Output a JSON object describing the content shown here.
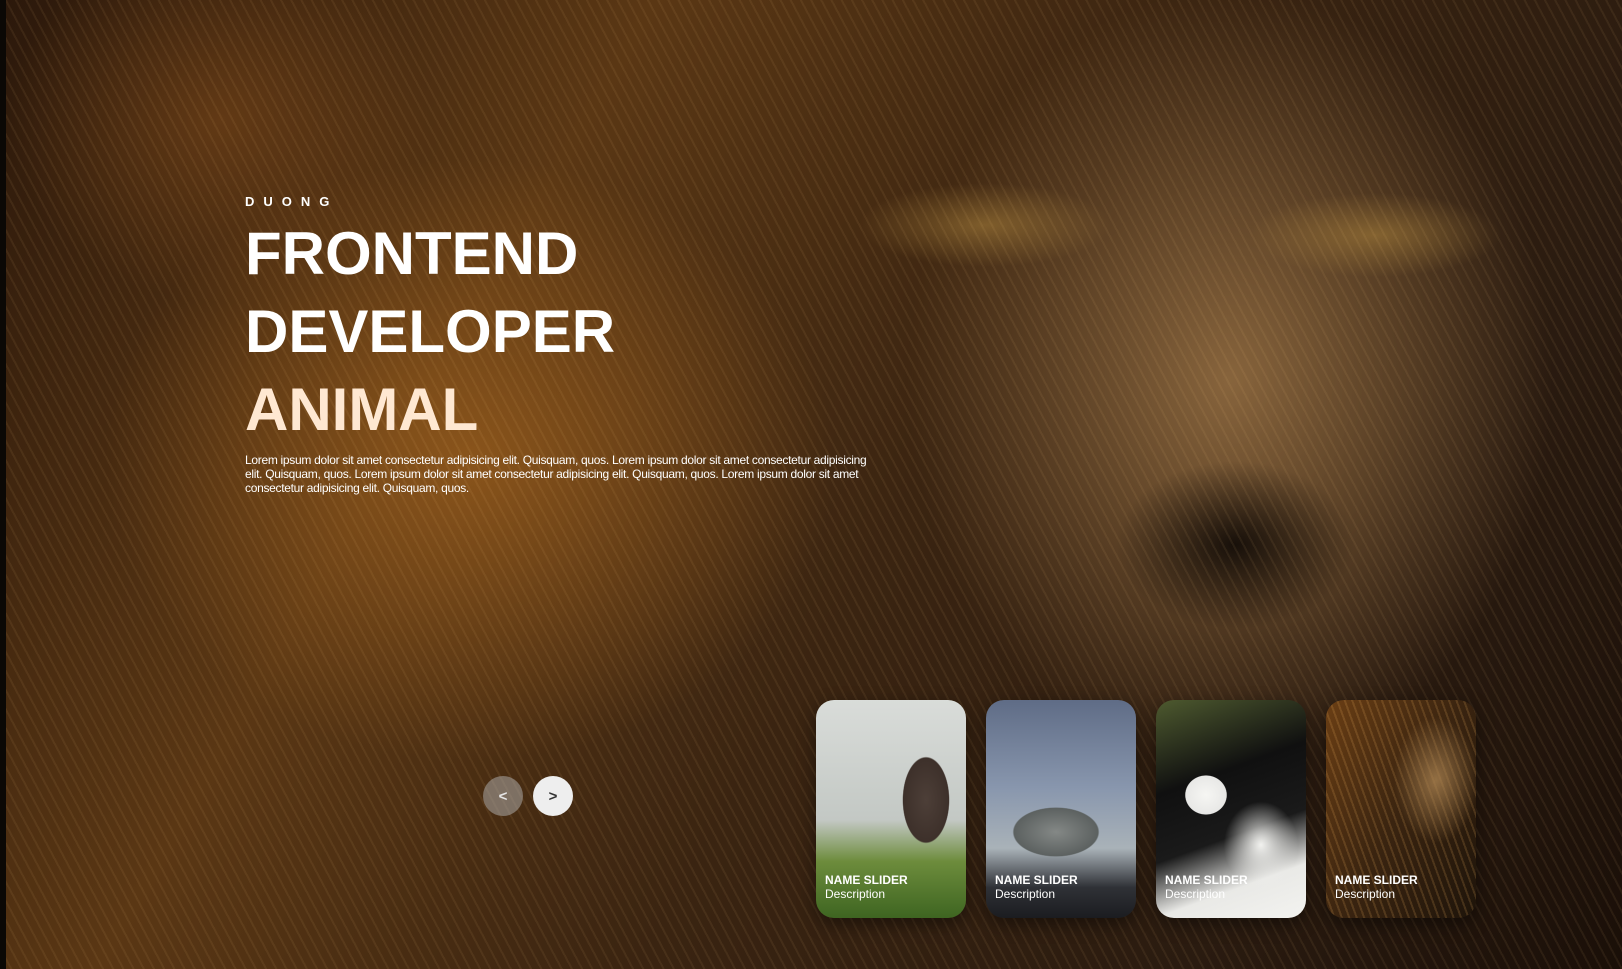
{
  "hero": {
    "eyebrow": "DUONG",
    "title_line1": "FRONTEND",
    "title_line2": "DEVELOPER",
    "title_line3": "ANIMAL",
    "description": "Lorem ipsum dolor sit amet consectetur adipisicing elit. Quisquam, quos. Lorem ipsum dolor sit amet consectetur adipisicing elit. Quisquam, quos. Lorem ipsum dolor sit amet consectetur adipisicing elit. Quisquam, quos. Lorem ipsum dolor sit amet consectetur adipisicing elit. Quisquam, quos."
  },
  "controls": {
    "prev_label": "<",
    "next_label": ">"
  },
  "cards": [
    {
      "title": "NAME SLIDER",
      "description": "Description",
      "animal": "hippo"
    },
    {
      "title": "NAME SLIDER",
      "description": "Description",
      "animal": "dinosaur"
    },
    {
      "title": "NAME SLIDER",
      "description": "Description",
      "animal": "panda"
    },
    {
      "title": "NAME SLIDER",
      "description": "Description",
      "animal": "lion"
    }
  ],
  "colors": {
    "title_text": "#ffffff",
    "accent_word": "#ffe8d2",
    "background": "#130c07"
  }
}
